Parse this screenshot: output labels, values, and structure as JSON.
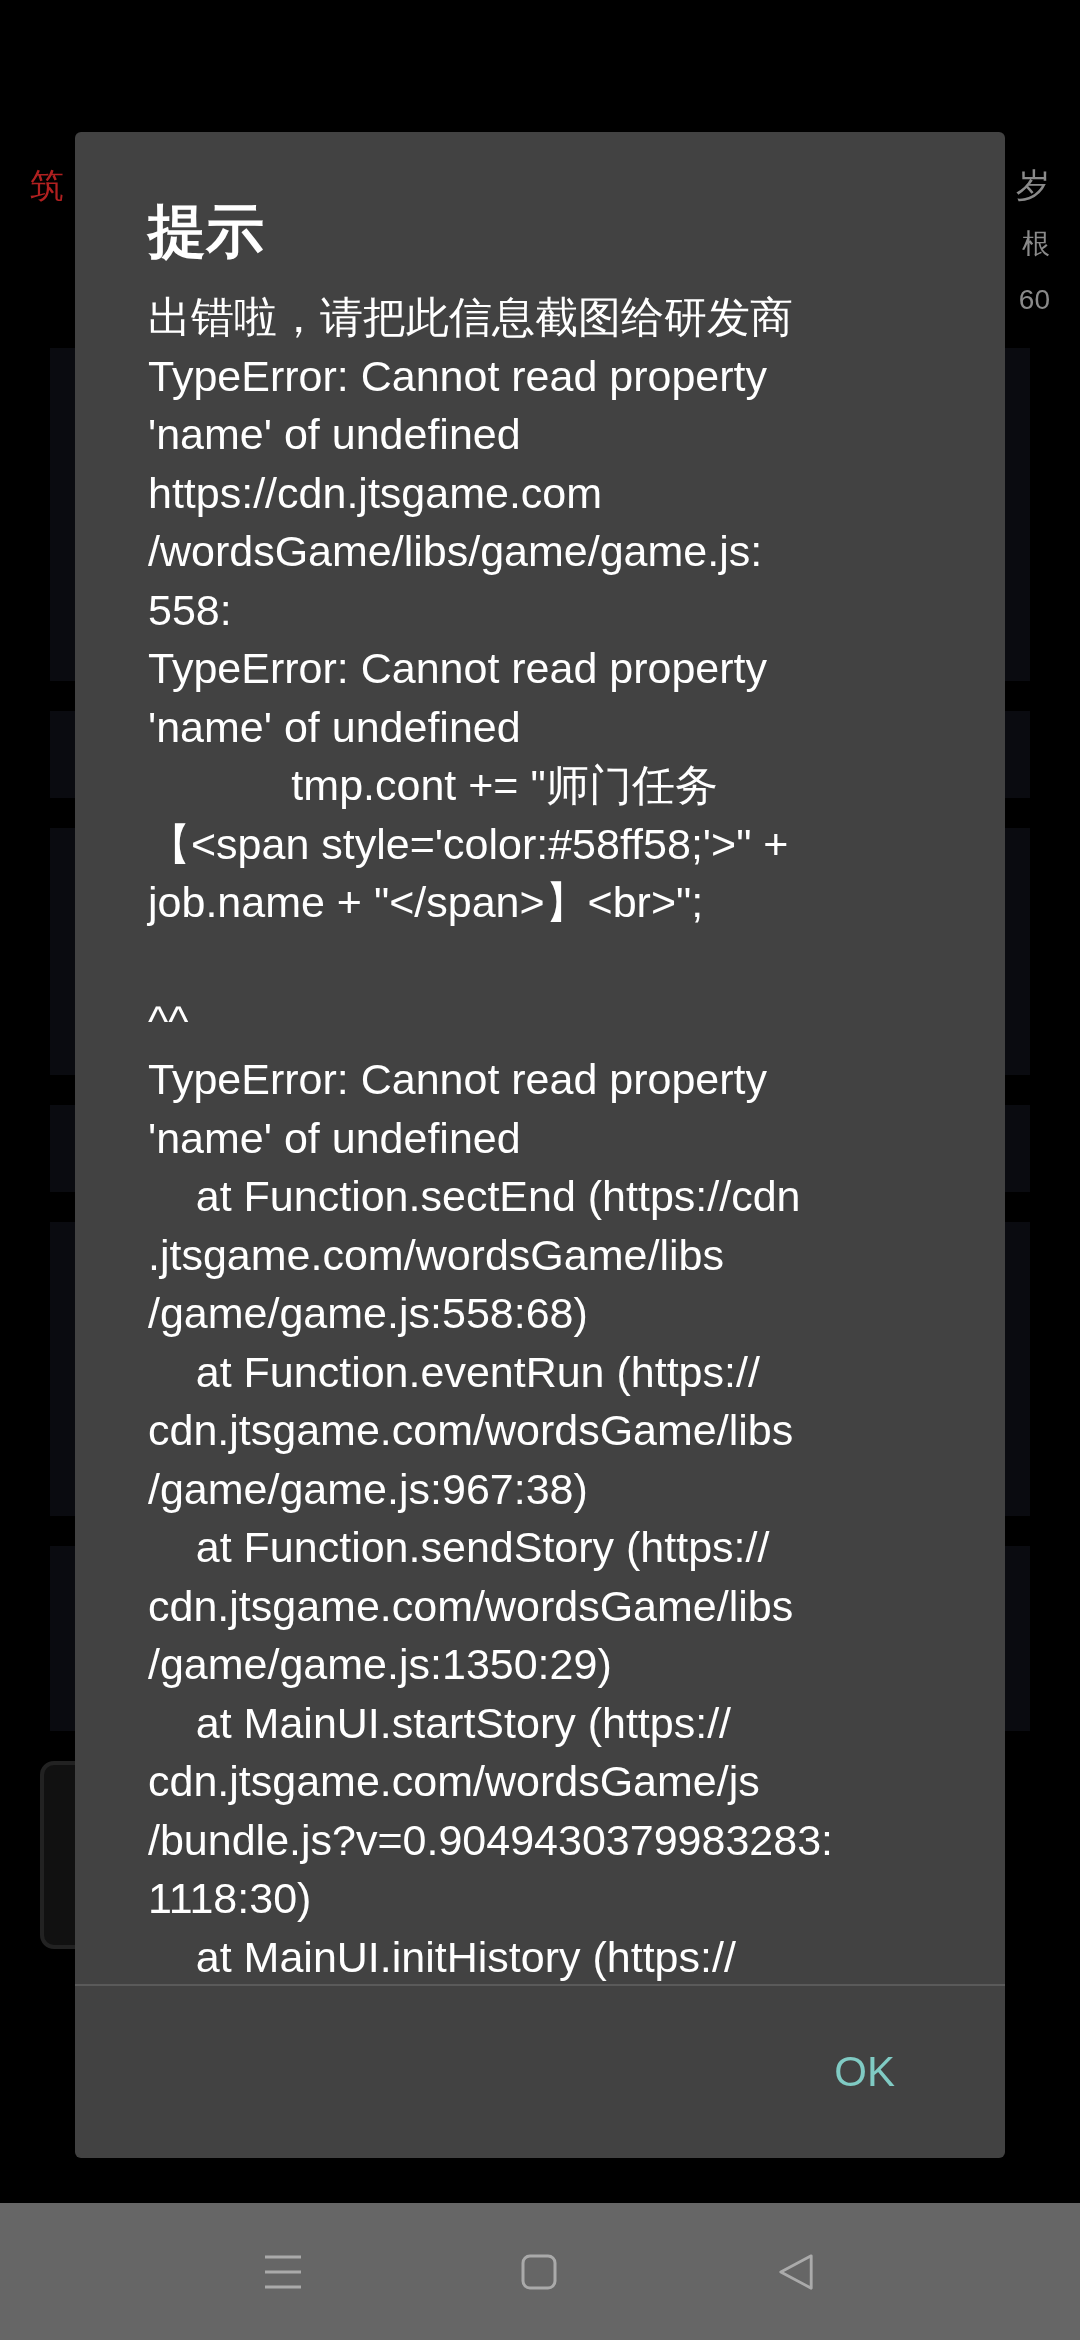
{
  "background": {
    "row_2": [
      {
        "text": "筑",
        "kind": "realm"
      },
      {
        "text": "岁",
        "kind": "info"
      }
    ],
    "row_3": [
      {
        "text": "根",
        "kind": "info"
      }
    ],
    "row_4": [
      {
        "text": "60",
        "kind": "info"
      }
    ]
  },
  "dialog": {
    "title": "提示",
    "message_lines": [
      "出错啦，请把此信息截图给研发商",
      "TypeError: Cannot read property",
      "'name' of undefined",
      "https://cdn.jtsgame.com",
      "/wordsGame/libs/game/game.js:",
      "558:",
      "TypeError: Cannot read property",
      "'name' of undefined",
      "            tmp.cont += \"师门任务",
      "【<span style='color:#58ff58;'>\" +",
      "job.name + \"</span>】<br>\";",
      "^^",
      "TypeError: Cannot read property",
      "'name' of undefined",
      "    at Function.sectEnd (https://cdn",
      ".jtsgame.com/wordsGame/libs",
      "/game/game.js:558:68)",
      "    at Function.eventRun (https://",
      "cdn.jtsgame.com/wordsGame/libs",
      "/game/game.js:967:38)",
      "    at Function.sendStory (https://",
      "cdn.jtsgame.com/wordsGame/libs",
      "/game/game.js:1350:29)",
      "    at MainUI.startStory (https://",
      "cdn.jtsgame.com/wordsGame/js",
      "/bundle.js?v=0.9049430379983283:",
      "1118:30)",
      "    at MainUI.initHistory (https://"
    ],
    "button": "OK"
  }
}
